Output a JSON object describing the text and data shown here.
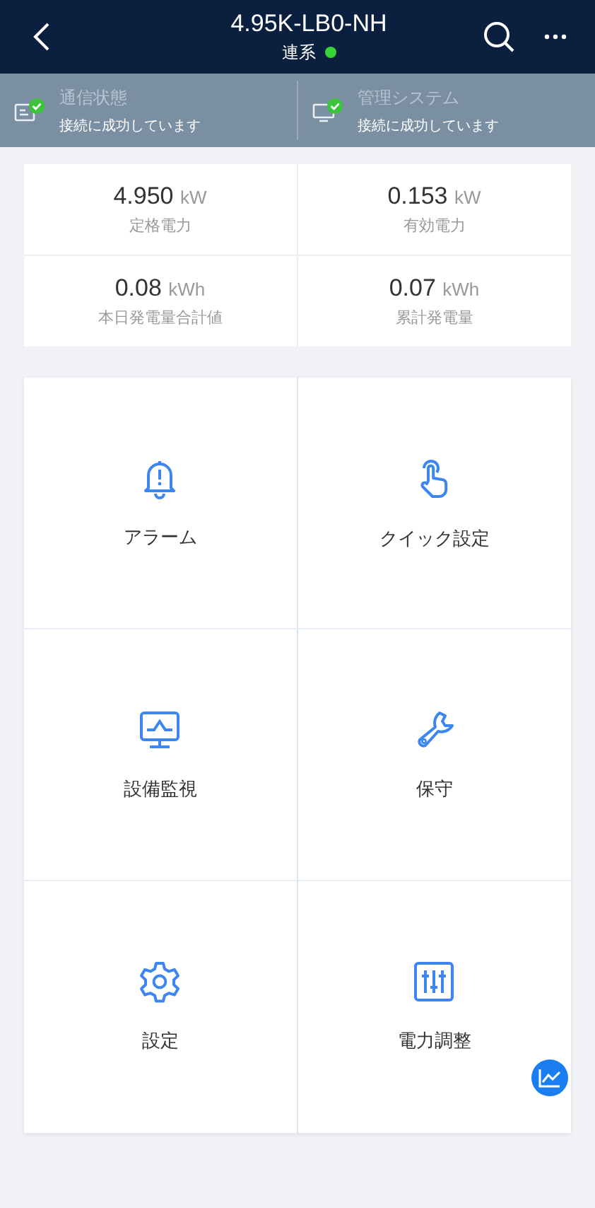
{
  "header": {
    "title": "4.95K-LB0-NH",
    "status": "連系",
    "online": true
  },
  "connections": [
    {
      "kind": "comm",
      "label": "通信状態",
      "value": "接続に成功しています",
      "ok": true
    },
    {
      "kind": "system",
      "label": "管理システム",
      "value": "接続に成功しています",
      "ok": true
    }
  ],
  "metrics": [
    {
      "value": "4.950",
      "unit": "kW",
      "label": "定格電力"
    },
    {
      "value": "0.153",
      "unit": "kW",
      "label": "有効電力"
    },
    {
      "value": "0.08",
      "unit": "kWh",
      "label": "本日発電量合計値"
    },
    {
      "value": "0.07",
      "unit": "kWh",
      "label": "累計発電量"
    }
  ],
  "menu": [
    {
      "kind": "alarm",
      "label": "アラーム"
    },
    {
      "kind": "touch",
      "label": "クイック設定"
    },
    {
      "kind": "monitor",
      "label": "設備監視"
    },
    {
      "kind": "wrench",
      "label": "保守"
    },
    {
      "kind": "gear",
      "label": "設定"
    },
    {
      "kind": "sliders",
      "label": "電力調整"
    }
  ]
}
